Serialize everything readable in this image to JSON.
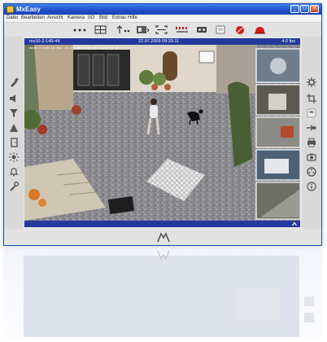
{
  "window": {
    "title": "MxEasy",
    "controls": {
      "minimize": "_",
      "maximize": "□",
      "close": "✕"
    }
  },
  "menu": [
    "Datei",
    "Bearbeiten",
    "Ansicht",
    "Kamera",
    "I/O",
    "Bild",
    "Extras",
    "Hilfe"
  ],
  "toolbar": {
    "icons": [
      "dots-icon",
      "layout-grid-icon",
      "arrows-icon",
      "split-view-icon",
      "fullscreen-icon",
      "signal-icon",
      "tape-icon",
      "notepad-icon",
      "record-icon",
      "alarm-icon"
    ]
  },
  "viewer": {
    "camera_label": "mx10-2-149-44",
    "timestamp": "22.07.2009 09:33:11",
    "fps": "4.0 fps",
    "scene_text": "mx10-2-149-44 Sat 22.07.2009 Sec Mx-Line 15:55"
  },
  "left_tools": [
    "paint-icon",
    "speaker-icon",
    "funnel-icon",
    "triangle-icon",
    "door-icon",
    "brightness-icon",
    "bell-icon",
    "wrench-icon"
  ],
  "right_tools": [
    "gear-icon",
    "crop-icon",
    "phone-icon",
    "arrow-icon",
    "printer-icon",
    "camera-icon",
    "reel-icon",
    "info-icon"
  ],
  "colors": {
    "title_bar": "#1c4fc8",
    "viewer_bar": "#233a9c",
    "record_red": "#d21c1c"
  }
}
